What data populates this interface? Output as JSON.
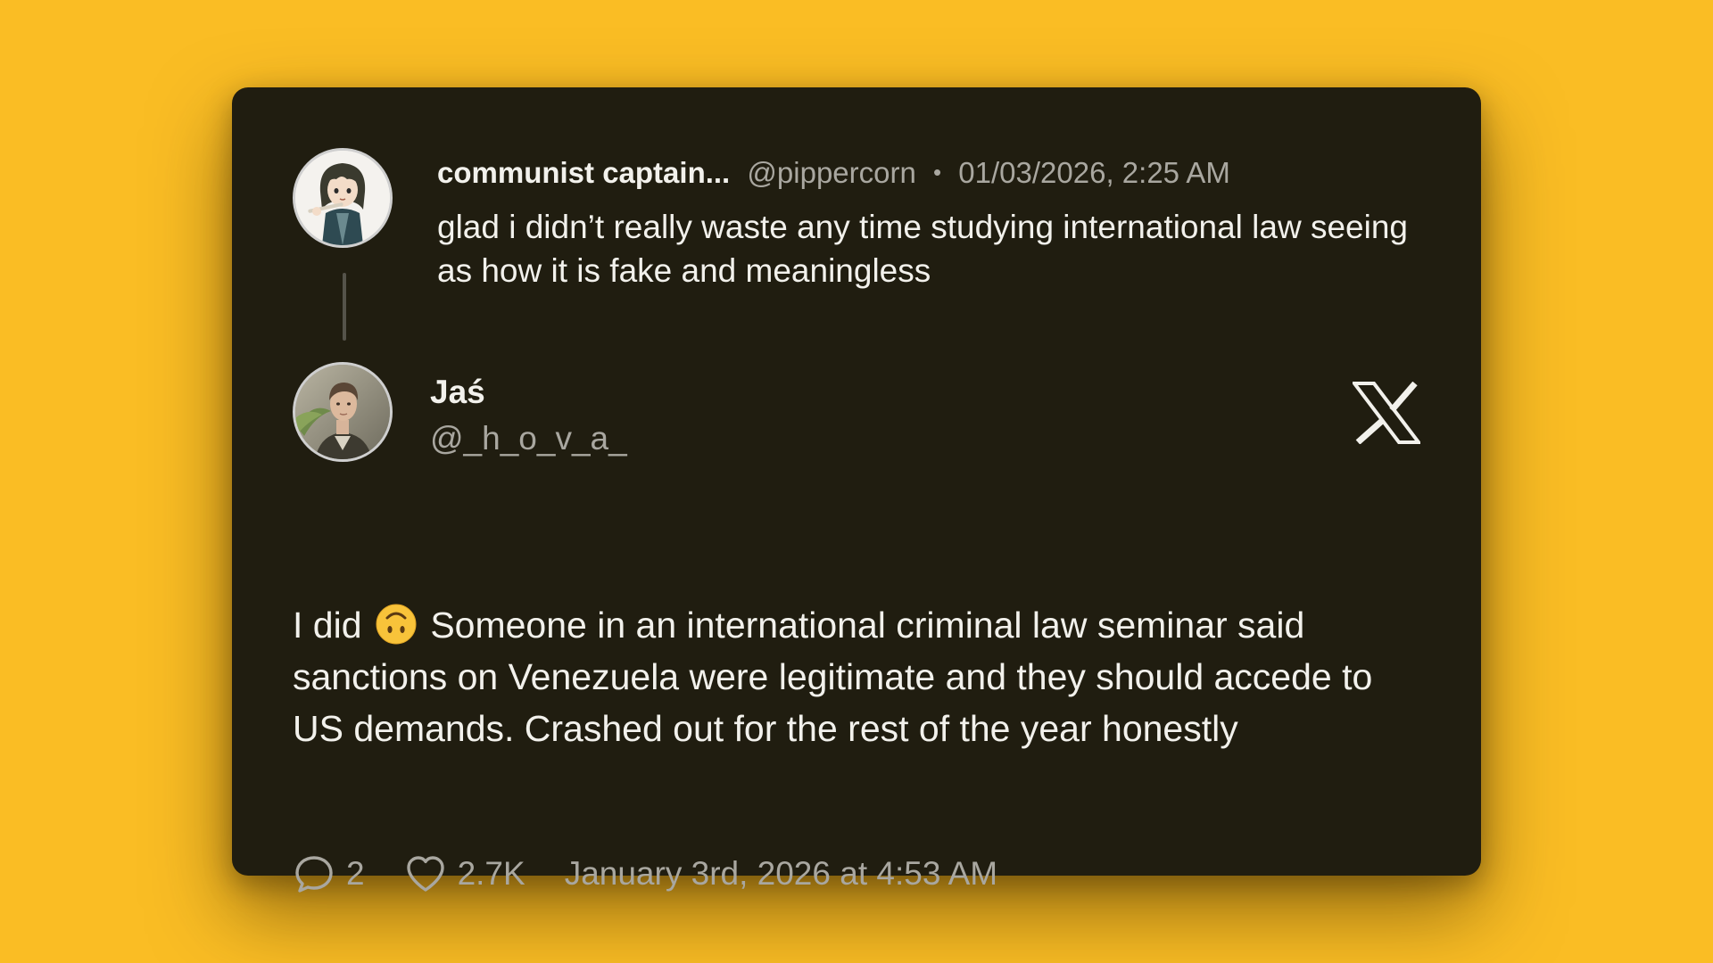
{
  "colors": {
    "background": "#FABD24",
    "card": "#201D10",
    "primary_text": "#F2F1EC",
    "secondary_text": "#A9A7A0"
  },
  "parent_tweet": {
    "display_name": "communist captain...",
    "handle": "@pippercorn",
    "separator": "•",
    "timestamp": "01/03/2026, 2:25 AM",
    "text": "glad i didn’t really waste any time studying international law seeing as how it is fake and meaningless",
    "avatar_icon": "anime-character-avatar"
  },
  "reply_tweet": {
    "display_name": "Jaś",
    "handle": "@_h_o_v_a_",
    "avatar_icon": "profile-photo-avatar",
    "text_before_emoji": "I did",
    "emoji_icon": "upside-down-face-emoji",
    "text_after_emoji": "Someone in an international criminal law seminar said sanctions on Venezuela were legitimate and they should accede to US demands. Crashed out for the rest of the year honestly"
  },
  "platform_icon": "x-logo-icon",
  "footer": {
    "reply_count": "2",
    "like_count": "2.7K",
    "timestamp": "January 3rd, 2026 at 4:53 AM",
    "reply_icon": "comment-bubble-icon",
    "like_icon": "heart-icon"
  }
}
